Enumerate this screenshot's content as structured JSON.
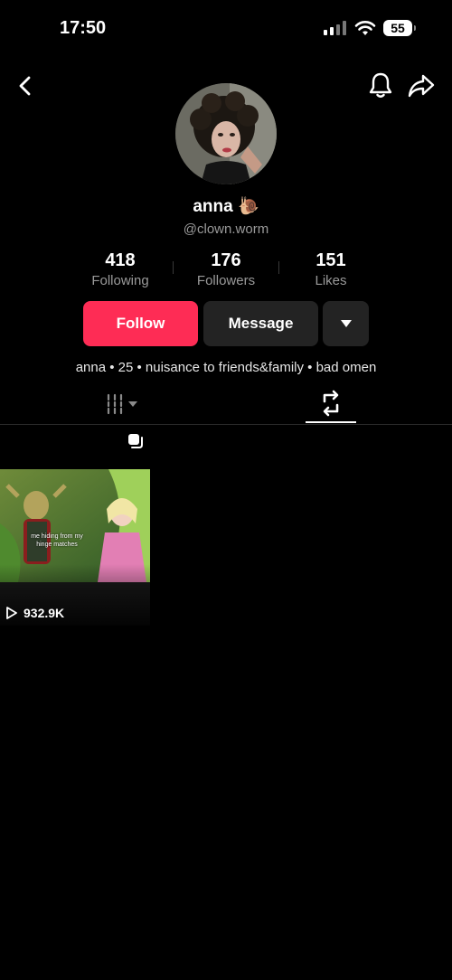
{
  "status_bar": {
    "time": "17:50",
    "battery": "55"
  },
  "profile": {
    "name": "anna 🐌",
    "handle": "@clown.worm",
    "stats": [
      {
        "value": "418",
        "label": "Following"
      },
      {
        "value": "176",
        "label": "Followers"
      },
      {
        "value": "151",
        "label": "Likes"
      }
    ],
    "bio": "anna • 25 • nuisance to friends&family • bad omen"
  },
  "actions": {
    "follow_label": "Follow",
    "message_label": "Message"
  },
  "videos": [
    {
      "caption": "me hiding from my hinge matches",
      "views": "932.9K"
    }
  ],
  "colors": {
    "accent": "#fe2c55",
    "background": "#000000",
    "button_dark": "#232323",
    "muted_text": "#9a9a9a"
  }
}
